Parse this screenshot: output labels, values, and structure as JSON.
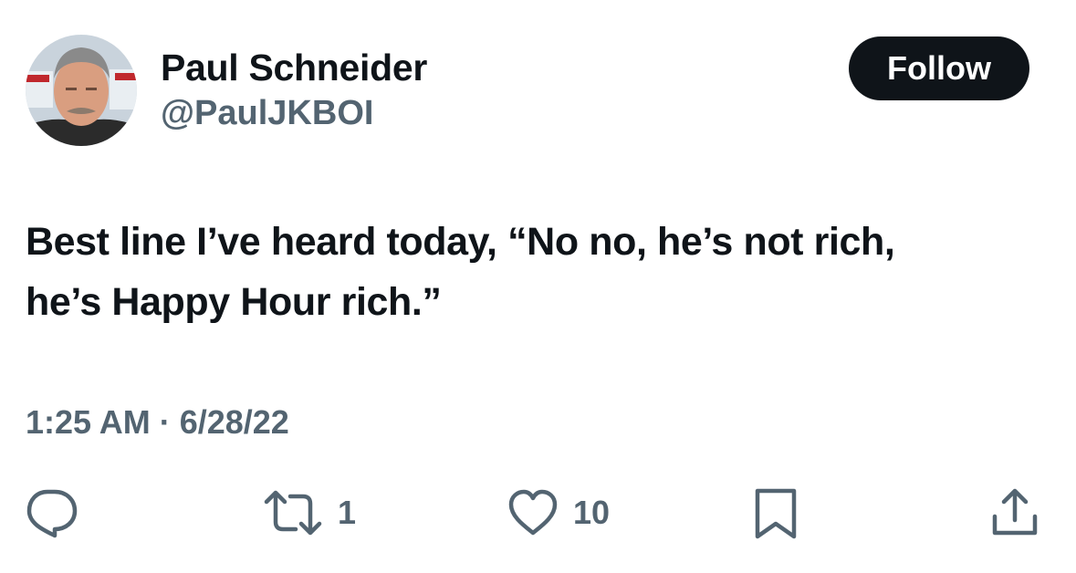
{
  "author": {
    "display_name": "Paul Schneider",
    "handle": "@PaulJKBOI"
  },
  "follow_label": "Follow",
  "tweet": {
    "text_line1": "Best line I’ve heard today, “No no, he’s not rich,",
    "text_line2": "he’s Happy Hour rich.”",
    "timestamp": "1:25 AM · 6/28/22"
  },
  "actions": {
    "reply": {
      "icon": "reply-icon"
    },
    "retweet": {
      "icon": "retweet-icon",
      "count": "1"
    },
    "like": {
      "icon": "heart-icon",
      "count": "10"
    },
    "bookmark": {
      "icon": "bookmark-icon"
    },
    "share": {
      "icon": "share-icon"
    }
  },
  "colors": {
    "text": "#0f1419",
    "secondary": "#536471",
    "button_bg": "#0f1419",
    "button_text": "#ffffff"
  }
}
